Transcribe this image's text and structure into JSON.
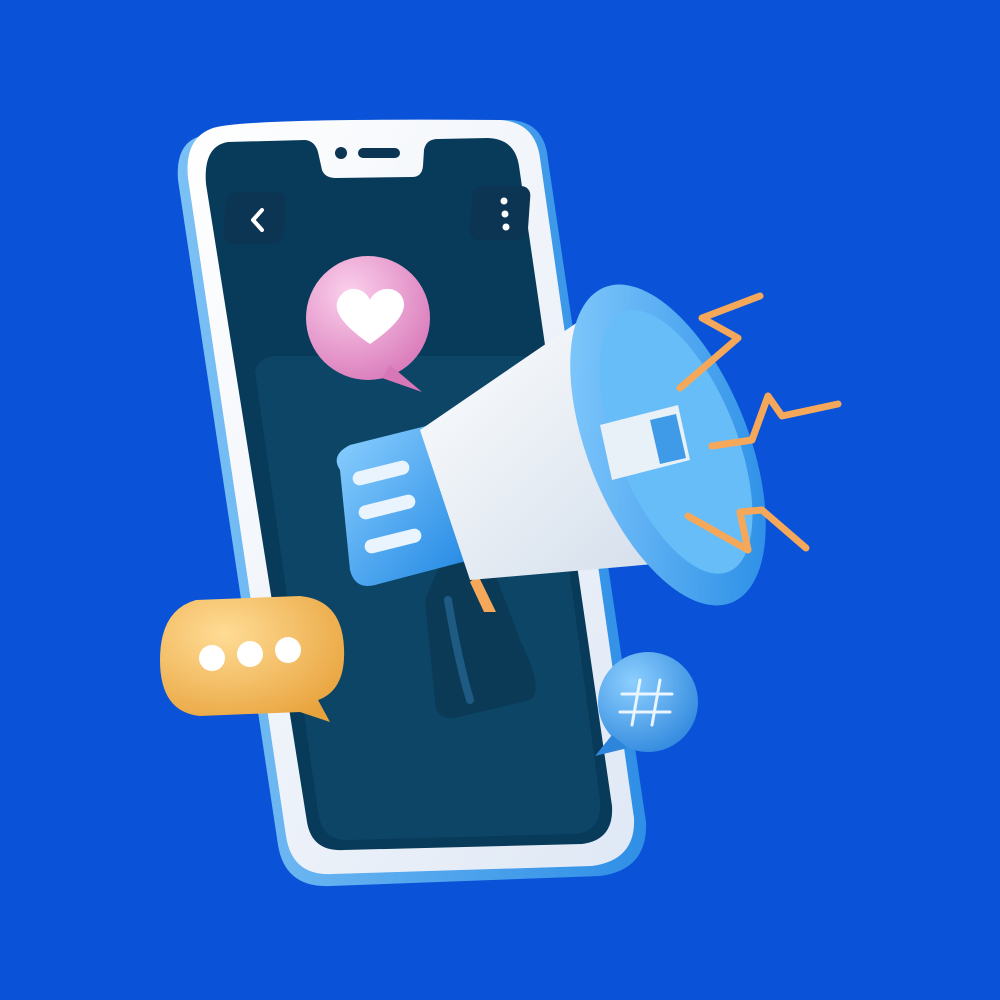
{
  "scene": {
    "subject": "phone-with-megaphone-illustration"
  },
  "colors": {
    "background": "#0a52d8",
    "phone_frame_outer": "#f1f5fb",
    "phone_frame_rim": "#4aa8f0",
    "phone_screen": "#083a59",
    "phone_screen_panel": "#0c4566",
    "nav_button": "#0b3552",
    "nav_glyph": "#ffffff",
    "heart_bubble": "#f3a7d6",
    "chat_bubble": "#f6c067",
    "hashtag_bubble": "#4ca7ee",
    "megaphone_horn": "#eef3f9",
    "megaphone_accent": "#45a7f2",
    "megaphone_handle": "#0b3a57",
    "sound_wave": "#f6a85a"
  },
  "icons": {
    "back": "chevron-left-icon",
    "menu": "more-vertical-icon",
    "heart": "heart-icon",
    "typing": "ellipsis-icon",
    "hashtag": "hashtag-icon",
    "megaphone": "megaphone-icon",
    "sound": "sound-wave-icon"
  }
}
